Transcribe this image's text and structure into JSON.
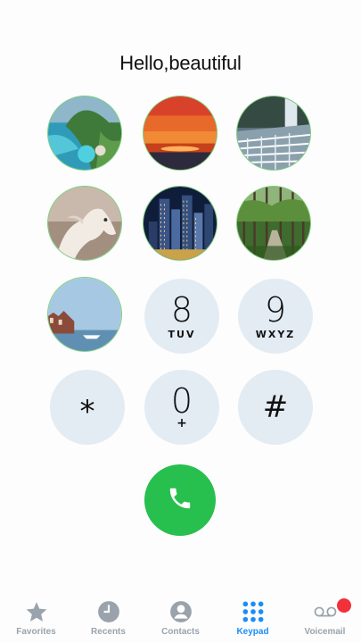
{
  "greeting": "Hello,beautiful",
  "photo_keys": [
    {
      "name": "photo-key-tropical-island"
    },
    {
      "name": "photo-key-sunset-sky"
    },
    {
      "name": "photo-key-waterfall-balcony"
    },
    {
      "name": "photo-key-white-horse"
    },
    {
      "name": "photo-key-city-skyline"
    },
    {
      "name": "photo-key-forest-path"
    },
    {
      "name": "photo-key-harbor-castle"
    }
  ],
  "dial_keys": [
    {
      "digit": "8",
      "letters": "TUV"
    },
    {
      "digit": "9",
      "letters": "WXYZ"
    },
    {
      "digit": "*",
      "letters": ""
    },
    {
      "digit": "0",
      "letters": "+"
    },
    {
      "digit": "#",
      "letters": ""
    }
  ],
  "call_button": {
    "icon": "phone-icon",
    "color": "#27bf4d"
  },
  "tabs": [
    {
      "label": "Favorites",
      "icon": "star-icon",
      "active": false
    },
    {
      "label": "Recents",
      "icon": "clock-icon",
      "active": false
    },
    {
      "label": "Contacts",
      "icon": "person-circle-icon",
      "active": false
    },
    {
      "label": "Keypad",
      "icon": "keypad-grid-icon",
      "active": true
    },
    {
      "label": "Voicemail",
      "icon": "voicemail-icon",
      "active": false
    }
  ],
  "colors": {
    "accent": "#1b8ef5",
    "inactive": "#9aa3ab",
    "key_bg": "#e3ecf3",
    "badge": "#f2303a"
  }
}
